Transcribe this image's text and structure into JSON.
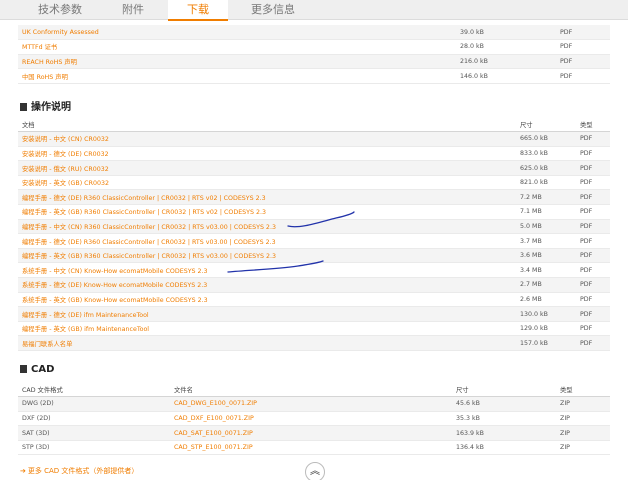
{
  "tabs": [
    "技术参数",
    "附件",
    "下载",
    "更多信息"
  ],
  "certificates": [
    {
      "name": "UK Conformity Assessed",
      "size": "39.0 kB",
      "type": "PDF"
    },
    {
      "name": "MTTFd 证书",
      "size": "28.0 kB",
      "type": "PDF"
    },
    {
      "name": "REACH RoHS 声明",
      "size": "216.0 kB",
      "type": "PDF"
    },
    {
      "name": "中国 RoHS 声明",
      "size": "146.0 kB",
      "type": "PDF"
    }
  ],
  "manuals": {
    "title": "操作说明",
    "headers": {
      "doc": "文档",
      "size": "尺寸",
      "type": "类型"
    },
    "rows": [
      {
        "name": "安装说明 - 中文 (CN) CR0032",
        "size": "665.0 kB",
        "type": "PDF"
      },
      {
        "name": "安装说明 - 德文 (DE) CR0032",
        "size": "833.0 kB",
        "type": "PDF"
      },
      {
        "name": "安装说明 - 俄文 (RU) CR0032",
        "size": "625.0 kB",
        "type": "PDF"
      },
      {
        "name": "安装说明 - 英文 (GB) CR0032",
        "size": "821.0 kB",
        "type": "PDF"
      },
      {
        "name": "编程手册 - 德文 (DE) R360 ClassicController | CR0032 | RTS v02 | CODESYS 2.3",
        "size": "7.2 MB",
        "type": "PDF"
      },
      {
        "name": "编程手册 - 英文 (GB) R360 ClassicController | CR0032 | RTS v02 | CODESYS 2.3",
        "size": "7.1 MB",
        "type": "PDF"
      },
      {
        "name": "编程手册 - 中文 (CN) R360 ClassicController | CR0032 | RTS v03.00 | CODESYS 2.3",
        "size": "5.0 MB",
        "type": "PDF"
      },
      {
        "name": "编程手册 - 德文 (DE) R360 ClassicController | CR0032 | RTS v03.00 | CODESYS 2.3",
        "size": "3.7 MB",
        "type": "PDF"
      },
      {
        "name": "编程手册 - 英文 (GB) R360 ClassicController | CR0032 | RTS v03.00 | CODESYS 2.3",
        "size": "3.6 MB",
        "type": "PDF"
      },
      {
        "name": "系统手册 - 中文 (CN) Know-How ecomatMobile CODESYS 2.3",
        "size": "3.4 MB",
        "type": "PDF"
      },
      {
        "name": "系统手册 - 德文 (DE) Know-How ecomatMobile CODESYS 2.3",
        "size": "2.7 MB",
        "type": "PDF"
      },
      {
        "name": "系统手册 - 英文 (GB) Know-How ecomatMobile CODESYS 2.3",
        "size": "2.6 MB",
        "type": "PDF"
      },
      {
        "name": "编程手册 - 德文 (DE) ifm MaintenanceTool",
        "size": "130.0 kB",
        "type": "PDF"
      },
      {
        "name": "编程手册 - 英文 (GB) ifm MaintenanceTool",
        "size": "129.0 kB",
        "type": "PDF"
      },
      {
        "name": "易福门联系人名单",
        "size": "157.0 kB",
        "type": "PDF"
      }
    ]
  },
  "cad": {
    "title": "CAD",
    "headers": {
      "format": "CAD 文件格式",
      "file": "文件名",
      "size": "尺寸",
      "type": "类型"
    },
    "rows": [
      {
        "format": "DWG (2D)",
        "file": "CAD_DWG_E100_0071.ZIP",
        "size": "45.6 kB",
        "type": "ZIP"
      },
      {
        "format": "DXF (2D)",
        "file": "CAD_DXF_E100_0071.ZIP",
        "size": "35.3 kB",
        "type": "ZIP"
      },
      {
        "format": "SAT (3D)",
        "file": "CAD_SAT_E100_0071.ZIP",
        "size": "163.9 kB",
        "type": "ZIP"
      },
      {
        "format": "STP (3D)",
        "file": "CAD_STP_E100_0071.ZIP",
        "size": "136.4 kB",
        "type": "ZIP"
      }
    ],
    "more_link": "更多 CAD 文件格式（外部提供者）"
  },
  "scroll_top_icon": "chevrons-up-icon",
  "colors": {
    "accent": "#f07d00",
    "annotation": "#2233aa"
  }
}
